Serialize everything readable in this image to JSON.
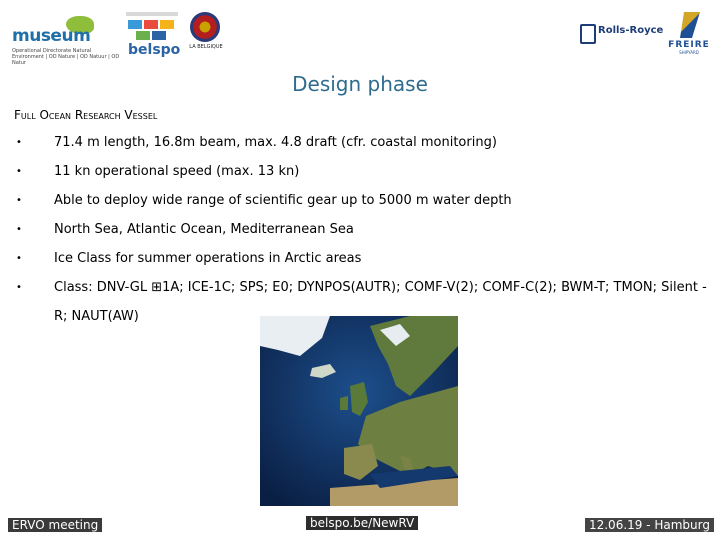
{
  "logos": {
    "museum": {
      "name": "museum",
      "subtitle": "Operational Directorate Natural Environment | OD Nature | OD Natuur | OD Natur"
    },
    "belspo": {
      "name": "belspo"
    },
    "seal": {
      "caption": "LA BELGIQUE"
    },
    "rolls_royce": {
      "name": "Rolls-Royce"
    },
    "freire": {
      "name": "FREIRE",
      "subtitle": "SHIPYARD"
    }
  },
  "slide": {
    "title": "Design phase",
    "heading": "Full Ocean Research Vessel",
    "bullets": [
      "71.4 m length, 16.8m beam, max. 4.8 draft (cfr. coastal monitoring)",
      "11 kn operational speed (max. 13 kn)",
      "Able to deploy wide range of scientific gear up to 5000 m water depth",
      "North Sea, Atlantic Ocean, Mediterranean Sea",
      "Ice Class for summer operations in Arctic areas",
      "Class: DNV-GL ⊞1A; ICE-1C; SPS; E0; DYNPOS(AUTR); COMF-V(2); COMF-C(2); BWM-T; TMON; Silent -R; NAUT(AW)"
    ],
    "bullet_glyph": "•"
  },
  "map": {
    "alt": "satellite-map-europe"
  },
  "footer": {
    "left": "ERVO meeting",
    "center": "belspo.be/NewRV",
    "right": "12.06.19 -  Hamburg"
  },
  "colors": {
    "title": "#2e6b8e",
    "ocean": "#0e2a56",
    "land": "#5f7a3c"
  }
}
